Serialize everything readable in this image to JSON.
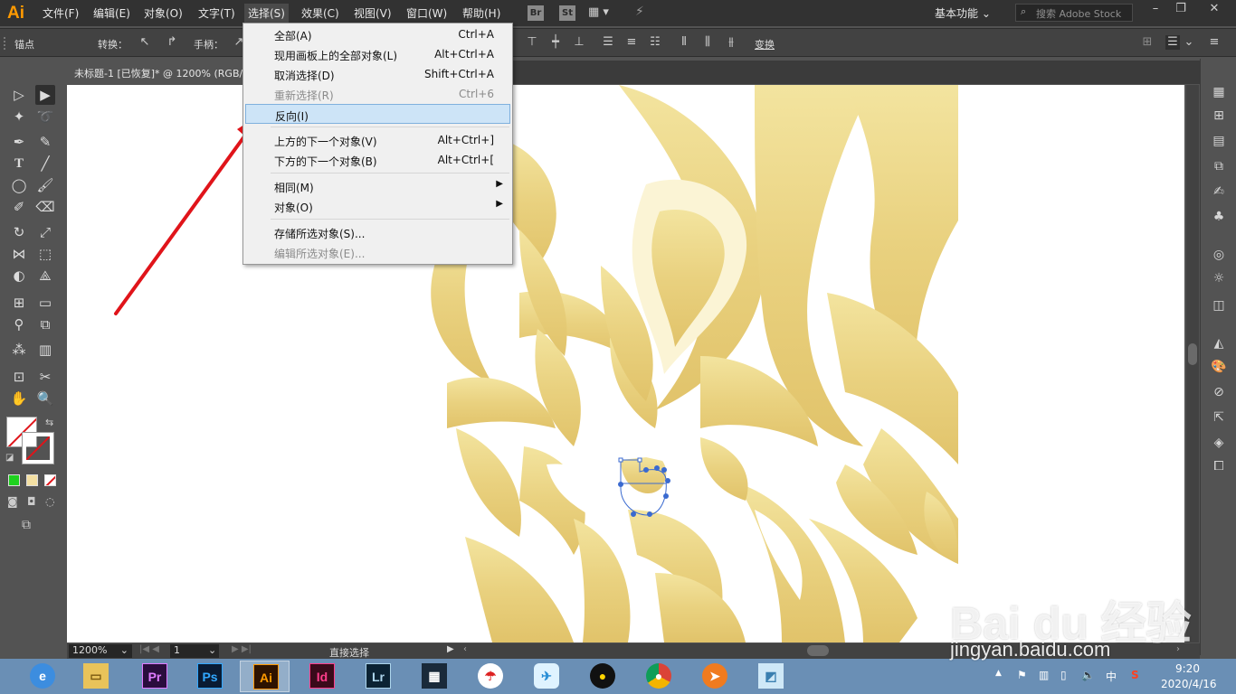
{
  "app": {
    "logo": "Ai",
    "menus": [
      "文件(F)",
      "编辑(E)",
      "对象(O)",
      "文字(T)",
      "选择(S)",
      "效果(C)",
      "视图(V)",
      "窗口(W)",
      "帮助(H)"
    ],
    "active_menu": "选择(S)",
    "bridge_badge": "Br",
    "stock_badge": "St",
    "workspace": "基本功能",
    "search_placeholder": "搜索 Adobe Stock"
  },
  "control_bar": {
    "anchor_label": "锚点",
    "convert_label": "转换：",
    "handle_label": "手柄：",
    "transform_label": "变换"
  },
  "document": {
    "tab_title": "未标题-1 [已恢复]* @ 1200% (RGB/GPU 预览)",
    "zoom": "1200%",
    "page": "1",
    "status_tool": "直接选择"
  },
  "dropdown": {
    "items": [
      {
        "label": "全部(A)",
        "shortcut": "Ctrl+A",
        "enabled": true
      },
      {
        "label": "现用画板上的全部对象(L)",
        "shortcut": "Alt+Ctrl+A",
        "enabled": true
      },
      {
        "label": "取消选择(D)",
        "shortcut": "Shift+Ctrl+A",
        "enabled": true
      },
      {
        "label": "重新选择(R)",
        "shortcut": "Ctrl+6",
        "enabled": false
      },
      {
        "label": "反向(I)",
        "shortcut": "",
        "enabled": true,
        "highlighted": true
      },
      {
        "label": "上方的下一个对象(V)",
        "shortcut": "Alt+Ctrl+]",
        "enabled": true
      },
      {
        "label": "下方的下一个对象(B)",
        "shortcut": "Alt+Ctrl+[",
        "enabled": true
      },
      {
        "label": "相同(M)",
        "shortcut": "",
        "enabled": true,
        "submenu": true
      },
      {
        "label": "对象(O)",
        "shortcut": "",
        "enabled": true,
        "submenu": true
      },
      {
        "label": "存储所选对象(S)...",
        "shortcut": "",
        "enabled": true
      },
      {
        "label": "编辑所选对象(E)...",
        "shortcut": "",
        "enabled": false
      }
    ]
  },
  "taskbar": {
    "apps": [
      "ie",
      "explorer",
      "Pr",
      "Ps",
      "Ai",
      "Id",
      "Lr",
      "video",
      "game",
      "bird",
      "qq",
      "chrome",
      "fox",
      "notes"
    ],
    "time": "9:20",
    "date": "2020/4/16",
    "ime": "中"
  },
  "watermark": {
    "logo_text": "Bai du 经验",
    "url": "jingyan.baidu.com"
  },
  "colors": {
    "accent": "#ff9a00",
    "artwork_gold": "#e8cf7a",
    "arrow_red": "#e0141a",
    "selection_blue": "#3a6ad0"
  }
}
